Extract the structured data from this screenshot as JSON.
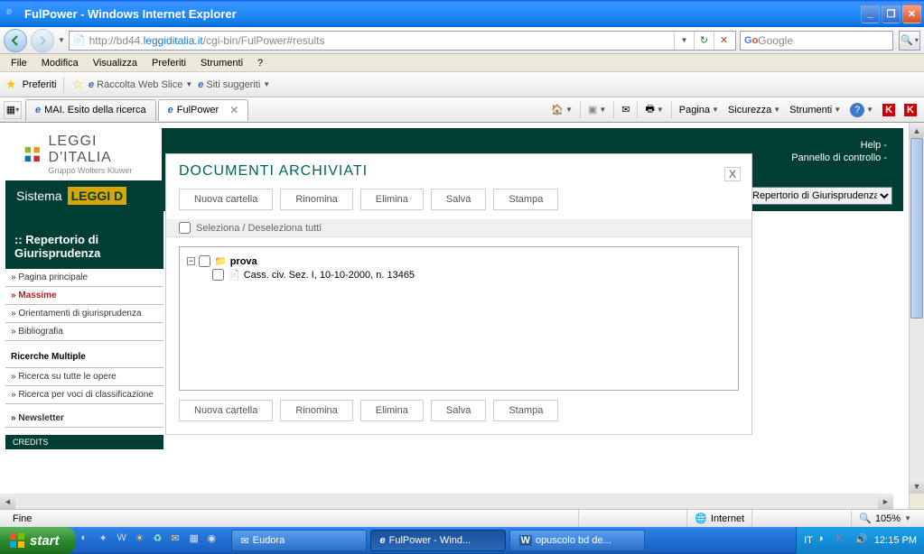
{
  "window": {
    "title": "FulPower - Windows Internet Explorer"
  },
  "nav": {
    "url_prefix": "http://bd44.",
    "url_host": "leggiditalia.it",
    "url_path": "/cgi-bin/FulPower#results",
    "search_placeholder": "Google"
  },
  "menu": {
    "items": [
      "File",
      "Modifica",
      "Visualizza",
      "Preferiti",
      "Strumenti",
      "?"
    ]
  },
  "favbar": {
    "preferiti": "Preferiti",
    "raccolta": "Raccolta Web Slice",
    "siti": "Siti suggeriti"
  },
  "tabs": [
    {
      "label": "MAI. Esito della ricerca",
      "active": false
    },
    {
      "label": "FulPower",
      "active": true
    }
  ],
  "cmdbar": {
    "pagina": "Pagina",
    "sicurezza": "Sicurezza",
    "strumenti": "Strumenti"
  },
  "logo": {
    "main": "LEGGI D'ITALIA",
    "sub": "Gruppo Wolters Kluwer"
  },
  "header_links": {
    "help": "Help -",
    "panel": "Pannello di controllo -"
  },
  "sistema": "Sistema",
  "sistema_brand": "LEGGI D",
  "select_value": "Repertorio di Giurisprudenza",
  "sidebar": {
    "title1": ":: Repertorio di",
    "title2": "Giurisprudenza",
    "links": [
      "Pagina principale",
      "Massime",
      "Orientamenti di giurisprudenza",
      "Bibliografia"
    ],
    "section": "Ricerche Multiple",
    "sub": [
      "Ricerca su tutte le opere",
      "Ricerca per voci di classificazione"
    ],
    "newsletter": "Newsletter",
    "credits": "CREDITS"
  },
  "modal": {
    "title": "DOCUMENTI ARCHIVIATI",
    "close": "X",
    "buttons": [
      "Nuova cartella",
      "Rinomina",
      "Elimina",
      "Salva",
      "Stampa"
    ],
    "select_all": "Seleziona / Deseleziona tutti",
    "folder": "prova",
    "doc": "Cass. civ. Sez. I, 10-10-2000, n. 13465"
  },
  "status": {
    "left": "Fine",
    "zone": "Internet",
    "zoom": "105%"
  },
  "taskbar": {
    "start": "start",
    "items": [
      "Eudora",
      "FulPower - Wind...",
      "opuscolo bd de..."
    ],
    "lang": "IT",
    "time": "12:15 PM"
  }
}
